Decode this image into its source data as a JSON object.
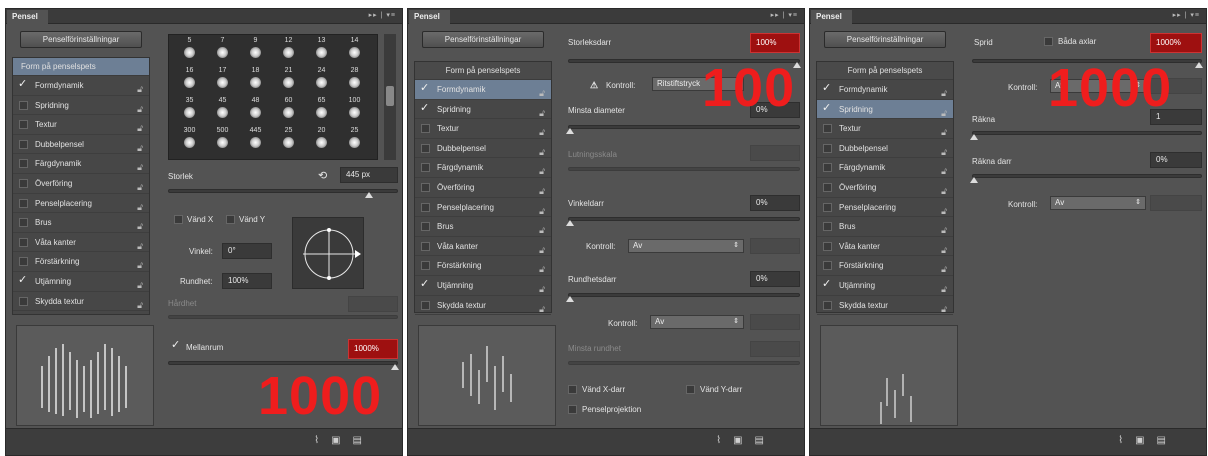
{
  "panels": [
    {
      "tab": "Pensel",
      "tabctl": "▸▸ | ▾≡",
      "preset_button": "Penselförinställningar",
      "list_header": "Form på penselspets",
      "items": [
        {
          "label": "Formdynamik",
          "checked": true
        },
        {
          "label": "Spridning",
          "checked": false
        },
        {
          "label": "Textur",
          "checked": false
        },
        {
          "label": "Dubbelpensel",
          "checked": false
        },
        {
          "label": "Färgdynamik",
          "checked": false
        },
        {
          "label": "Överföring",
          "checked": false
        },
        {
          "label": "Penselplacering",
          "checked": false
        },
        {
          "label": "Brus",
          "checked": false
        },
        {
          "label": "Våta kanter",
          "checked": false
        },
        {
          "label": "Förstärkning",
          "checked": false
        },
        {
          "label": "Utjämning",
          "checked": true
        },
        {
          "label": "Skydda textur",
          "checked": false
        }
      ],
      "tips": [
        [
          "5",
          "7",
          "9",
          "12",
          "13",
          "14"
        ],
        [
          "16",
          "17",
          "18",
          "21",
          "24",
          "28"
        ],
        [
          "35",
          "45",
          "48",
          "60",
          "65",
          "100"
        ],
        [
          "300",
          "500",
          "445",
          "25",
          "20",
          "25"
        ]
      ],
      "size_label": "Storlek",
      "size_value": "445 px",
      "flipx": "Vänd X",
      "flipy": "Vänd Y",
      "angle_label": "Vinkel:",
      "angle_value": "0°",
      "round_label": "Rundhet:",
      "round_value": "100%",
      "hardness_label": "Hårdhet",
      "spacing_label": "Mellanrum",
      "spacing_value": "1000%",
      "overlay": "1000"
    },
    {
      "tab": "Pensel",
      "tabctl": "▸▸ | ▾≡",
      "preset_button": "Penselförinställningar",
      "list_header": "Form på penselspets",
      "items": [
        {
          "label": "Formdynamik",
          "checked": true
        },
        {
          "label": "Spridning",
          "checked": true
        },
        {
          "label": "Textur",
          "checked": false
        },
        {
          "label": "Dubbelpensel",
          "checked": false
        },
        {
          "label": "Färgdynamik",
          "checked": false
        },
        {
          "label": "Överföring",
          "checked": false
        },
        {
          "label": "Penselplacering",
          "checked": false
        },
        {
          "label": "Brus",
          "checked": false
        },
        {
          "label": "Våta kanter",
          "checked": false
        },
        {
          "label": "Förstärkning",
          "checked": false
        },
        {
          "label": "Utjämning",
          "checked": true
        },
        {
          "label": "Skydda textur",
          "checked": false
        }
      ],
      "size_jitter_label": "Storleksdarr",
      "size_jitter_value": "100%",
      "control_label": "Kontroll:",
      "control_value": "Ritstiftstryck",
      "min_diameter_label": "Minsta diameter",
      "min_diameter_value": "0%",
      "tilt_scale_label": "Lutningsskala",
      "angle_jitter_label": "Vinkeldarr",
      "angle_jitter_value": "0%",
      "control2_value": "Av",
      "round_jitter_label": "Rundhetsdarr",
      "round_jitter_value": "0%",
      "control3_value": "Av",
      "min_round_label": "Minsta rundhet",
      "flipx_jitter": "Vänd X-darr",
      "flipy_jitter": "Vänd Y-darr",
      "brush_projection": "Penselprojektion",
      "overlay": "100"
    },
    {
      "tab": "Pensel",
      "tabctl": "▸▸ | ▾≡",
      "preset_button": "Penselförinställningar",
      "list_header": "Form på penselspets",
      "items": [
        {
          "label": "Formdynamik",
          "checked": true
        },
        {
          "label": "Spridning",
          "checked": true
        },
        {
          "label": "Textur",
          "checked": false
        },
        {
          "label": "Dubbelpensel",
          "checked": false
        },
        {
          "label": "Färgdynamik",
          "checked": false
        },
        {
          "label": "Överföring",
          "checked": false
        },
        {
          "label": "Penselplacering",
          "checked": false
        },
        {
          "label": "Brus",
          "checked": false
        },
        {
          "label": "Våta kanter",
          "checked": false
        },
        {
          "label": "Förstärkning",
          "checked": false
        },
        {
          "label": "Utjämning",
          "checked": true
        },
        {
          "label": "Skydda textur",
          "checked": false
        }
      ],
      "scatter_label": "Sprid",
      "both_axes_label": "Båda axlar",
      "scatter_value": "1000%",
      "control_label": "Kontroll:",
      "control_value": "Av",
      "count_label": "Räkna",
      "count_value": "1",
      "count_jitter_label": "Räkna darr",
      "count_jitter_value": "0%",
      "control2_value": "Av",
      "overlay": "1000"
    }
  ]
}
